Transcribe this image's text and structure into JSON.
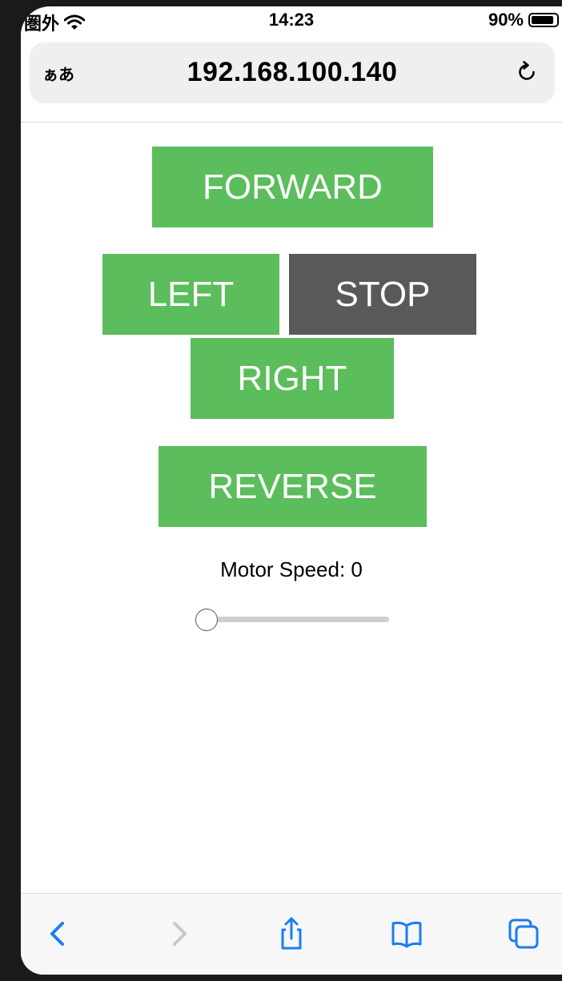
{
  "status_bar": {
    "carrier": "圏外",
    "time": "14:23",
    "battery": "90%",
    "battery_level": 0.9,
    "icons": [
      "wifi-icon",
      "battery-icon"
    ]
  },
  "address_bar": {
    "text_size_label": "ぁあ",
    "url": "192.168.100.140",
    "reload_icon": "reload-icon"
  },
  "controls": {
    "forward": "FORWARD",
    "left": "LEFT",
    "stop": "STOP",
    "right": "RIGHT",
    "reverse": "REVERSE"
  },
  "speed": {
    "label": "Motor Speed: 0",
    "value": 0,
    "min": 0,
    "max": 100
  },
  "colors": {
    "primary_button": "#5bbd5b",
    "stop_button": "#595959",
    "ios_blue": "#1a7cf5",
    "disabled_gray": "#c8c8c8"
  },
  "toolbar": {
    "icons": [
      "back-icon",
      "forward-icon",
      "share-icon",
      "bookmarks-icon",
      "tabs-icon"
    ]
  }
}
